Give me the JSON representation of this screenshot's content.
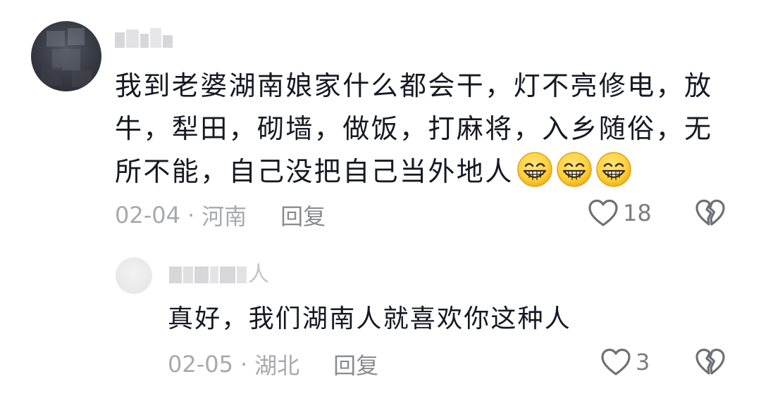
{
  "comment": {
    "username": "",
    "text": "我到老婆湖南娘家什么都会干，灯不亮修电，放牛，犁田，砌墙，做饭，打麻将，入乡随俗，无所不能，自己没把自己当外地人",
    "emoji": [
      "grinning-face-icon",
      "grinning-face-icon",
      "grinning-face-icon"
    ],
    "date": "02-04",
    "separator": "·",
    "location": "河南",
    "reply_label": "回复",
    "like_count": "18"
  },
  "reply": {
    "username_visible_suffix": "人",
    "text": "真好，我们湖南人就喜欢你这种人",
    "date": "02-05",
    "separator": "·",
    "location": "湖北",
    "reply_label": "回复",
    "like_count": "3"
  },
  "colors": {
    "text": "#161823",
    "meta": "#a8a9ad",
    "reply_link": "#8a8b8f",
    "icon_stroke": "#6f7075",
    "emoji_face": "#ffd23e"
  }
}
